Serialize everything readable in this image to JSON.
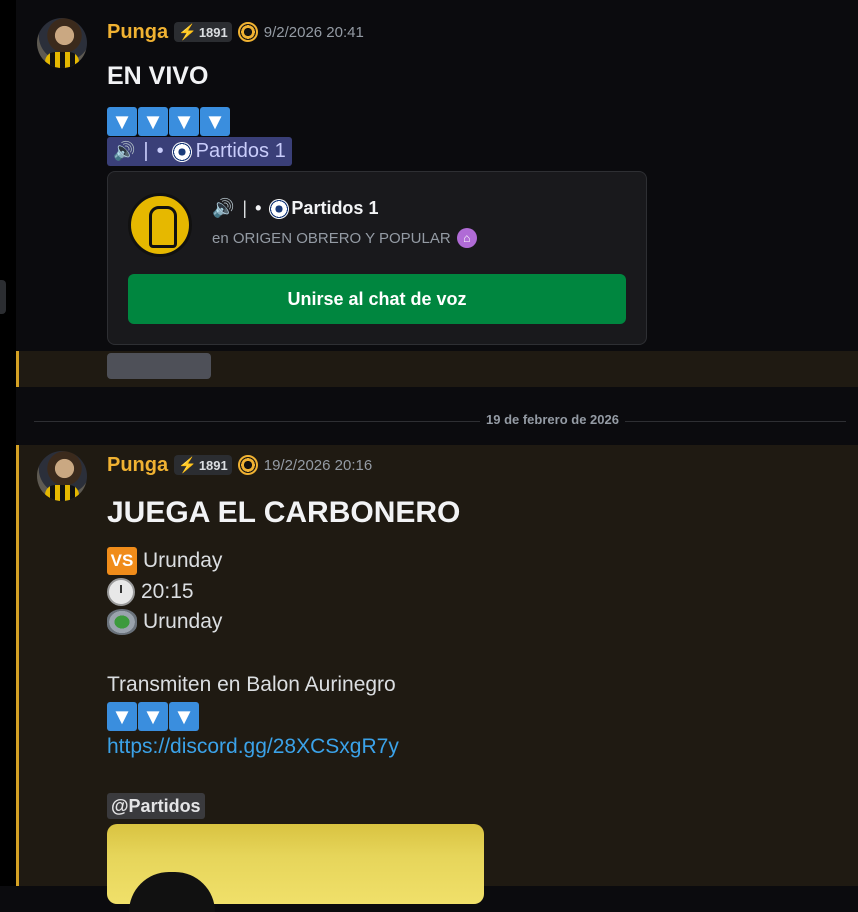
{
  "message1": {
    "author": "Punga",
    "tag_icon": "⚡",
    "tag_number": "1891",
    "timestamp": "9/2/2026 20:41",
    "title": "EN VIVO",
    "arrows": [
      "▼",
      "▼",
      "▼",
      "▼"
    ],
    "channel_mention": {
      "speaker_icon": "🔊",
      "separator": "|",
      "bullet": "•",
      "label": "Partidos 1"
    },
    "voice_card": {
      "channel": "Partidos 1",
      "separator": "|",
      "bullet": "•",
      "server": "en ORIGEN OBRERO Y POPULAR",
      "join_label": "Unirse al chat de voz"
    }
  },
  "date_divider": "19 de febrero de 2026",
  "message2": {
    "author": "Punga",
    "tag_icon": "⚡",
    "tag_number": "1891",
    "timestamp": "19/2/2026 20:16",
    "title": "JUEGA EL CARBONERO",
    "vs_label": "VS",
    "opponent": "Urunday",
    "time": "20:15",
    "venue": "Urunday",
    "broadcast": "Transmiten en Balon Aurinegro",
    "arrows": [
      "▼",
      "▼",
      "▼"
    ],
    "link": "https://discord.gg/28XCSxgR7y",
    "role_mention": "@Partidos"
  },
  "colors": {
    "author": "#f0b232",
    "mention_bg": "#3a3f78",
    "join_button": "#00863f",
    "link": "#3ba2e8",
    "highlight_border": "#d4a124"
  }
}
